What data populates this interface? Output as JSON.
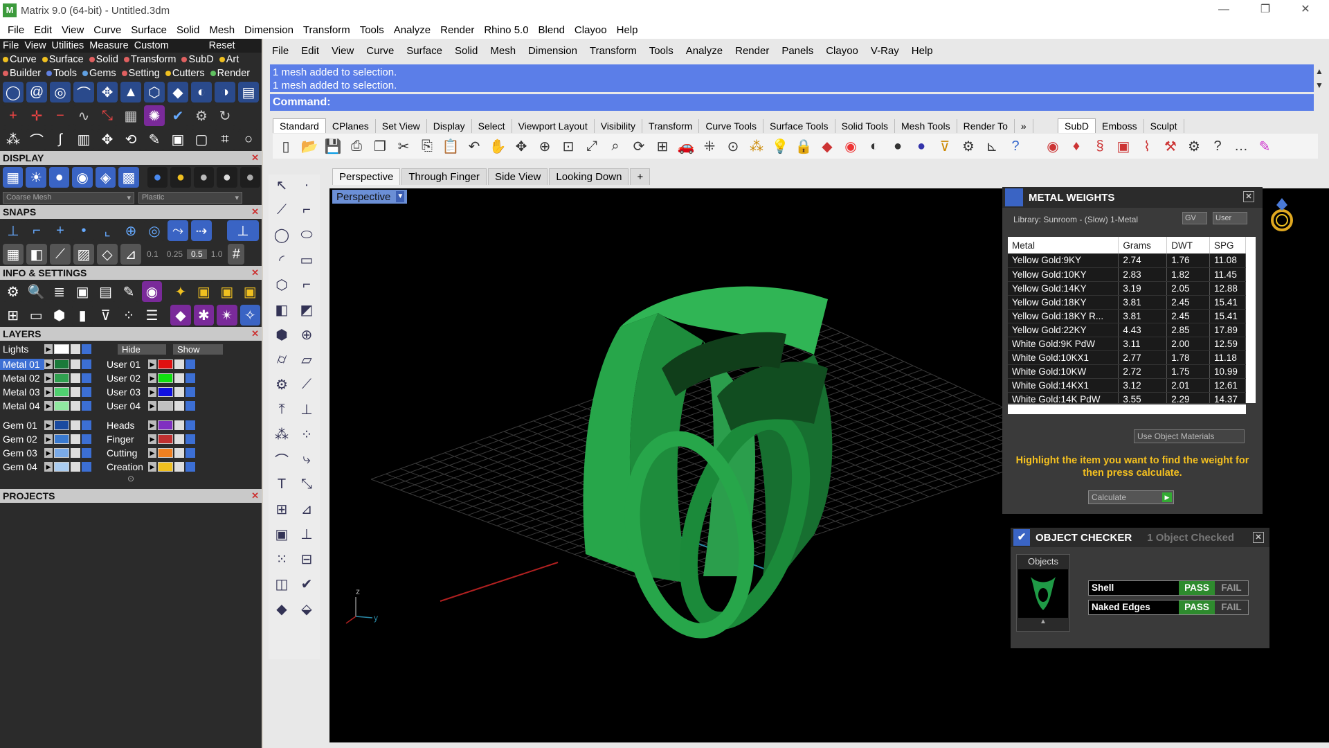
{
  "window": {
    "title": "Matrix 9.0 (64-bit) - Untitled.3dm",
    "controls": [
      "—",
      "❐",
      "✕"
    ]
  },
  "main_menu": [
    "File",
    "Edit",
    "View",
    "Curve",
    "Surface",
    "Solid",
    "Mesh",
    "Dimension",
    "Transform",
    "Tools",
    "Analyze",
    "Render",
    "Rhino 5.0",
    "Blend",
    "Clayoo",
    "Help"
  ],
  "left_panel": {
    "menu": [
      "File",
      "View",
      "Utilities",
      "Measure",
      "Custom"
    ],
    "reset_label": "Reset",
    "categories_row1": [
      {
        "label": "Curve",
        "color": "#f0c020"
      },
      {
        "label": "Surface",
        "color": "#f0c020"
      },
      {
        "label": "Solid",
        "color": "#e06060"
      },
      {
        "label": "Transform",
        "color": "#e06060"
      },
      {
        "label": "SubD",
        "color": "#e06060"
      },
      {
        "label": "Art",
        "color": "#f0c020"
      }
    ],
    "categories_row2": [
      {
        "label": "Builder",
        "color": "#e06060"
      },
      {
        "label": "Tools",
        "color": "#6080e0"
      },
      {
        "label": "Gems",
        "color": "#60a0e0"
      },
      {
        "label": "Setting",
        "color": "#e06060"
      },
      {
        "label": "Cutters",
        "color": "#f0c020"
      },
      {
        "label": "Render",
        "color": "#60c060"
      }
    ],
    "sections": {
      "display": "DISPLAY",
      "snaps": "SNAPS",
      "info_settings": "INFO & SETTINGS",
      "layers": "LAYERS",
      "projects": "PROJECTS"
    },
    "display_mesh": "Coarse Mesh",
    "display_material": "Plastic",
    "snap_values": [
      "0.1",
      "0.25",
      "0.5",
      "1.0"
    ],
    "lights_label": "Lights",
    "hide_label": "Hide",
    "show_label": "Show",
    "layers_left": [
      {
        "name": "Metal 01",
        "color": "#1a7a3a",
        "selected": true
      },
      {
        "name": "Metal 02",
        "color": "#30a050",
        "selected": false
      },
      {
        "name": "Metal 03",
        "color": "#50d070",
        "selected": false
      },
      {
        "name": "Metal 04",
        "color": "#90e8a0",
        "selected": false
      },
      {
        "name": "Gem 01",
        "color": "#1a4aa0",
        "selected": false
      },
      {
        "name": "Gem 02",
        "color": "#3a7ad0",
        "selected": false
      },
      {
        "name": "Gem 03",
        "color": "#7aaae8",
        "selected": false
      },
      {
        "name": "Gem 04",
        "color": "#aaccf0",
        "selected": false
      }
    ],
    "layers_right": [
      {
        "name": "User 01",
        "color": "#e01010"
      },
      {
        "name": "User 02",
        "color": "#10e010"
      },
      {
        "name": "User 03",
        "color": "#1010e0"
      },
      {
        "name": "User 04",
        "color": "#c0c0c0"
      },
      {
        "name": "Heads",
        "color": "#8030c0"
      },
      {
        "name": "Finger",
        "color": "#c03030"
      },
      {
        "name": "Cutting",
        "color": "#f08020"
      },
      {
        "name": "Creation",
        "color": "#f0c020"
      }
    ]
  },
  "rhino": {
    "menu": [
      "File",
      "Edit",
      "View",
      "Curve",
      "Surface",
      "Solid",
      "Mesh",
      "Dimension",
      "Transform",
      "Tools",
      "Analyze",
      "Render",
      "Panels",
      "Clayoo",
      "V-Ray",
      "Help"
    ],
    "command_history": [
      "1 mesh added to selection.",
      "1 mesh added to selection."
    ],
    "command_label": "Command:",
    "command_value": "",
    "toolbar_tabs": [
      "Standard",
      "CPlanes",
      "Set View",
      "Display",
      "Select",
      "Viewport Layout",
      "Visibility",
      "Transform",
      "Curve Tools",
      "Surface Tools",
      "Solid Tools",
      "Mesh Tools",
      "Render To"
    ],
    "toolbar_tabs_more": "»",
    "toolbar_tabs_right": [
      "SubD",
      "Emboss",
      "Sculpt"
    ],
    "viewport_tabs": [
      "Perspective",
      "Through Finger",
      "Side View",
      "Looking Down"
    ],
    "viewport_add": "+",
    "viewport_label": "Perspective",
    "axis_labels": {
      "z": "z",
      "y": "y"
    }
  },
  "metal_weights": {
    "title": "METAL WEIGHTS",
    "library": "Library: Sunroom - (Slow) 1-Metal",
    "gv_label": "GV",
    "user_label": "User",
    "columns": [
      "Metal",
      "Grams",
      "DWT",
      "SPG"
    ],
    "rows": [
      [
        "Yellow Gold:9KY",
        "2.74",
        "1.76",
        "11.08"
      ],
      [
        "Yellow Gold:10KY",
        "2.83",
        "1.82",
        "11.45"
      ],
      [
        "Yellow Gold:14KY",
        "3.19",
        "2.05",
        "12.88"
      ],
      [
        "Yellow Gold:18KY",
        "3.81",
        "2.45",
        "15.41"
      ],
      [
        "Yellow Gold:18KY R...",
        "3.81",
        "2.45",
        "15.41"
      ],
      [
        "Yellow Gold:22KY",
        "4.43",
        "2.85",
        "17.89"
      ],
      [
        "White Gold:9K PdW",
        "3.11",
        "2.00",
        "12.59"
      ],
      [
        "White Gold:10KX1",
        "2.77",
        "1.78",
        "11.18"
      ],
      [
        "White Gold:10KW",
        "2.72",
        "1.75",
        "10.99"
      ],
      [
        "White Gold:14KX1",
        "3.12",
        "2.01",
        "12.61"
      ],
      [
        "White Gold:14K PdW",
        "3.55",
        "2.29",
        "14.37"
      ]
    ],
    "use_object_materials": "Use Object Materials",
    "hint": "Highlight the item you want to find the weight for then press calculate.",
    "calculate_label": "Calculate"
  },
  "object_checker": {
    "title": "OBJECT CHECKER",
    "count_label": "1 Object Checked",
    "objects_label": "Objects",
    "checks": [
      {
        "name": "Shell",
        "pass": "PASS",
        "fail": "FAIL"
      },
      {
        "name": "Naked Edges",
        "pass": "PASS",
        "fail": "FAIL"
      }
    ]
  }
}
